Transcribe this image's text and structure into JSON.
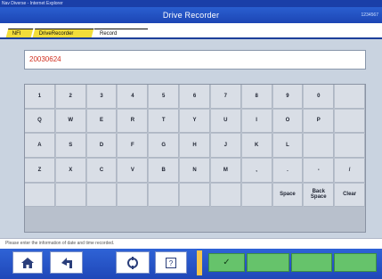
{
  "window": {
    "title": "Nav Diverse - Internet Explorer"
  },
  "app": {
    "title": "Drive Recorder",
    "tag": "1234567"
  },
  "tabs": [
    "NFI",
    "DriveRecorder",
    "Record"
  ],
  "entry": {
    "value": "20030624"
  },
  "keys": [
    [
      "1",
      "2",
      "3",
      "4",
      "5",
      "6",
      "7",
      "8",
      "9",
      "0",
      ""
    ],
    [
      "Q",
      "W",
      "E",
      "R",
      "T",
      "Y",
      "U",
      "I",
      "O",
      "P",
      ""
    ],
    [
      "A",
      "S",
      "D",
      "F",
      "G",
      "H",
      "J",
      "K",
      "L",
      "",
      ""
    ],
    [
      "Z",
      "X",
      "C",
      "V",
      "B",
      "N",
      "M",
      ",",
      ".",
      "-",
      "/"
    ],
    [
      "",
      "",
      "",
      "",
      "",
      "",
      "",
      "",
      "Space",
      "Back Space",
      "Clear"
    ]
  ],
  "status_text": "Please enter the information of date and time recorded.",
  "bottom": {
    "ok_icon": "✓"
  },
  "icons": {
    "home": "home-icon",
    "back": "back-icon",
    "unit": "unit-icon",
    "help": "help-icon",
    "ok": "checkmark-icon"
  },
  "colors": {
    "accent": "#1c45b4",
    "tab_active": "#f2dd3a",
    "ok_key": "#66c36b",
    "entry_text": "#d03020"
  }
}
